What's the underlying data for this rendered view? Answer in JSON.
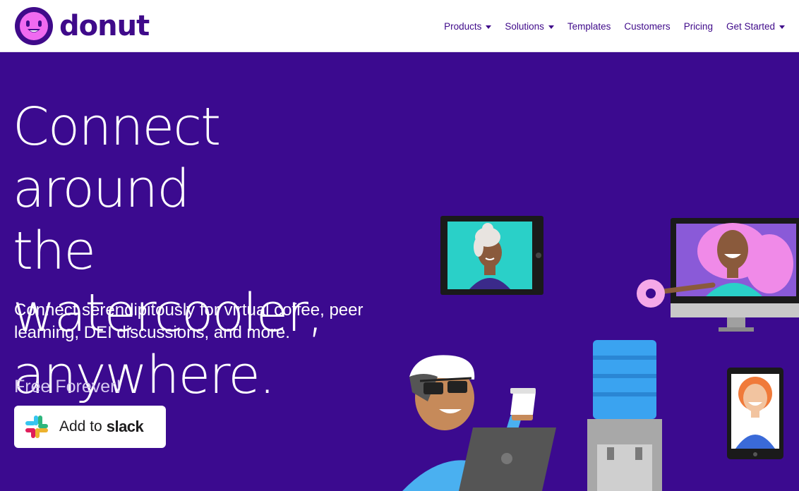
{
  "brand": {
    "name": "donut",
    "color": "#3f0a8a",
    "accent": "#f06af0"
  },
  "nav": {
    "items": [
      {
        "label": "Products",
        "has_dropdown": true
      },
      {
        "label": "Solutions",
        "has_dropdown": true
      },
      {
        "label": "Templates",
        "has_dropdown": false
      },
      {
        "label": "Customers",
        "has_dropdown": false
      },
      {
        "label": "Pricing",
        "has_dropdown": false
      },
      {
        "label": "Get Started",
        "has_dropdown": true
      }
    ]
  },
  "hero": {
    "background": "#3b0a8f",
    "headline": [
      "Connect around",
      "the watercooler,",
      "anywhere."
    ],
    "subtext": "Connect serendipitously for virtual coffee, peer learning, DEI discussions, and more.",
    "tagline": "Free Forever!",
    "cta": {
      "add": "Add to",
      "word": "slack",
      "icon": "slack-logo-icon"
    }
  }
}
